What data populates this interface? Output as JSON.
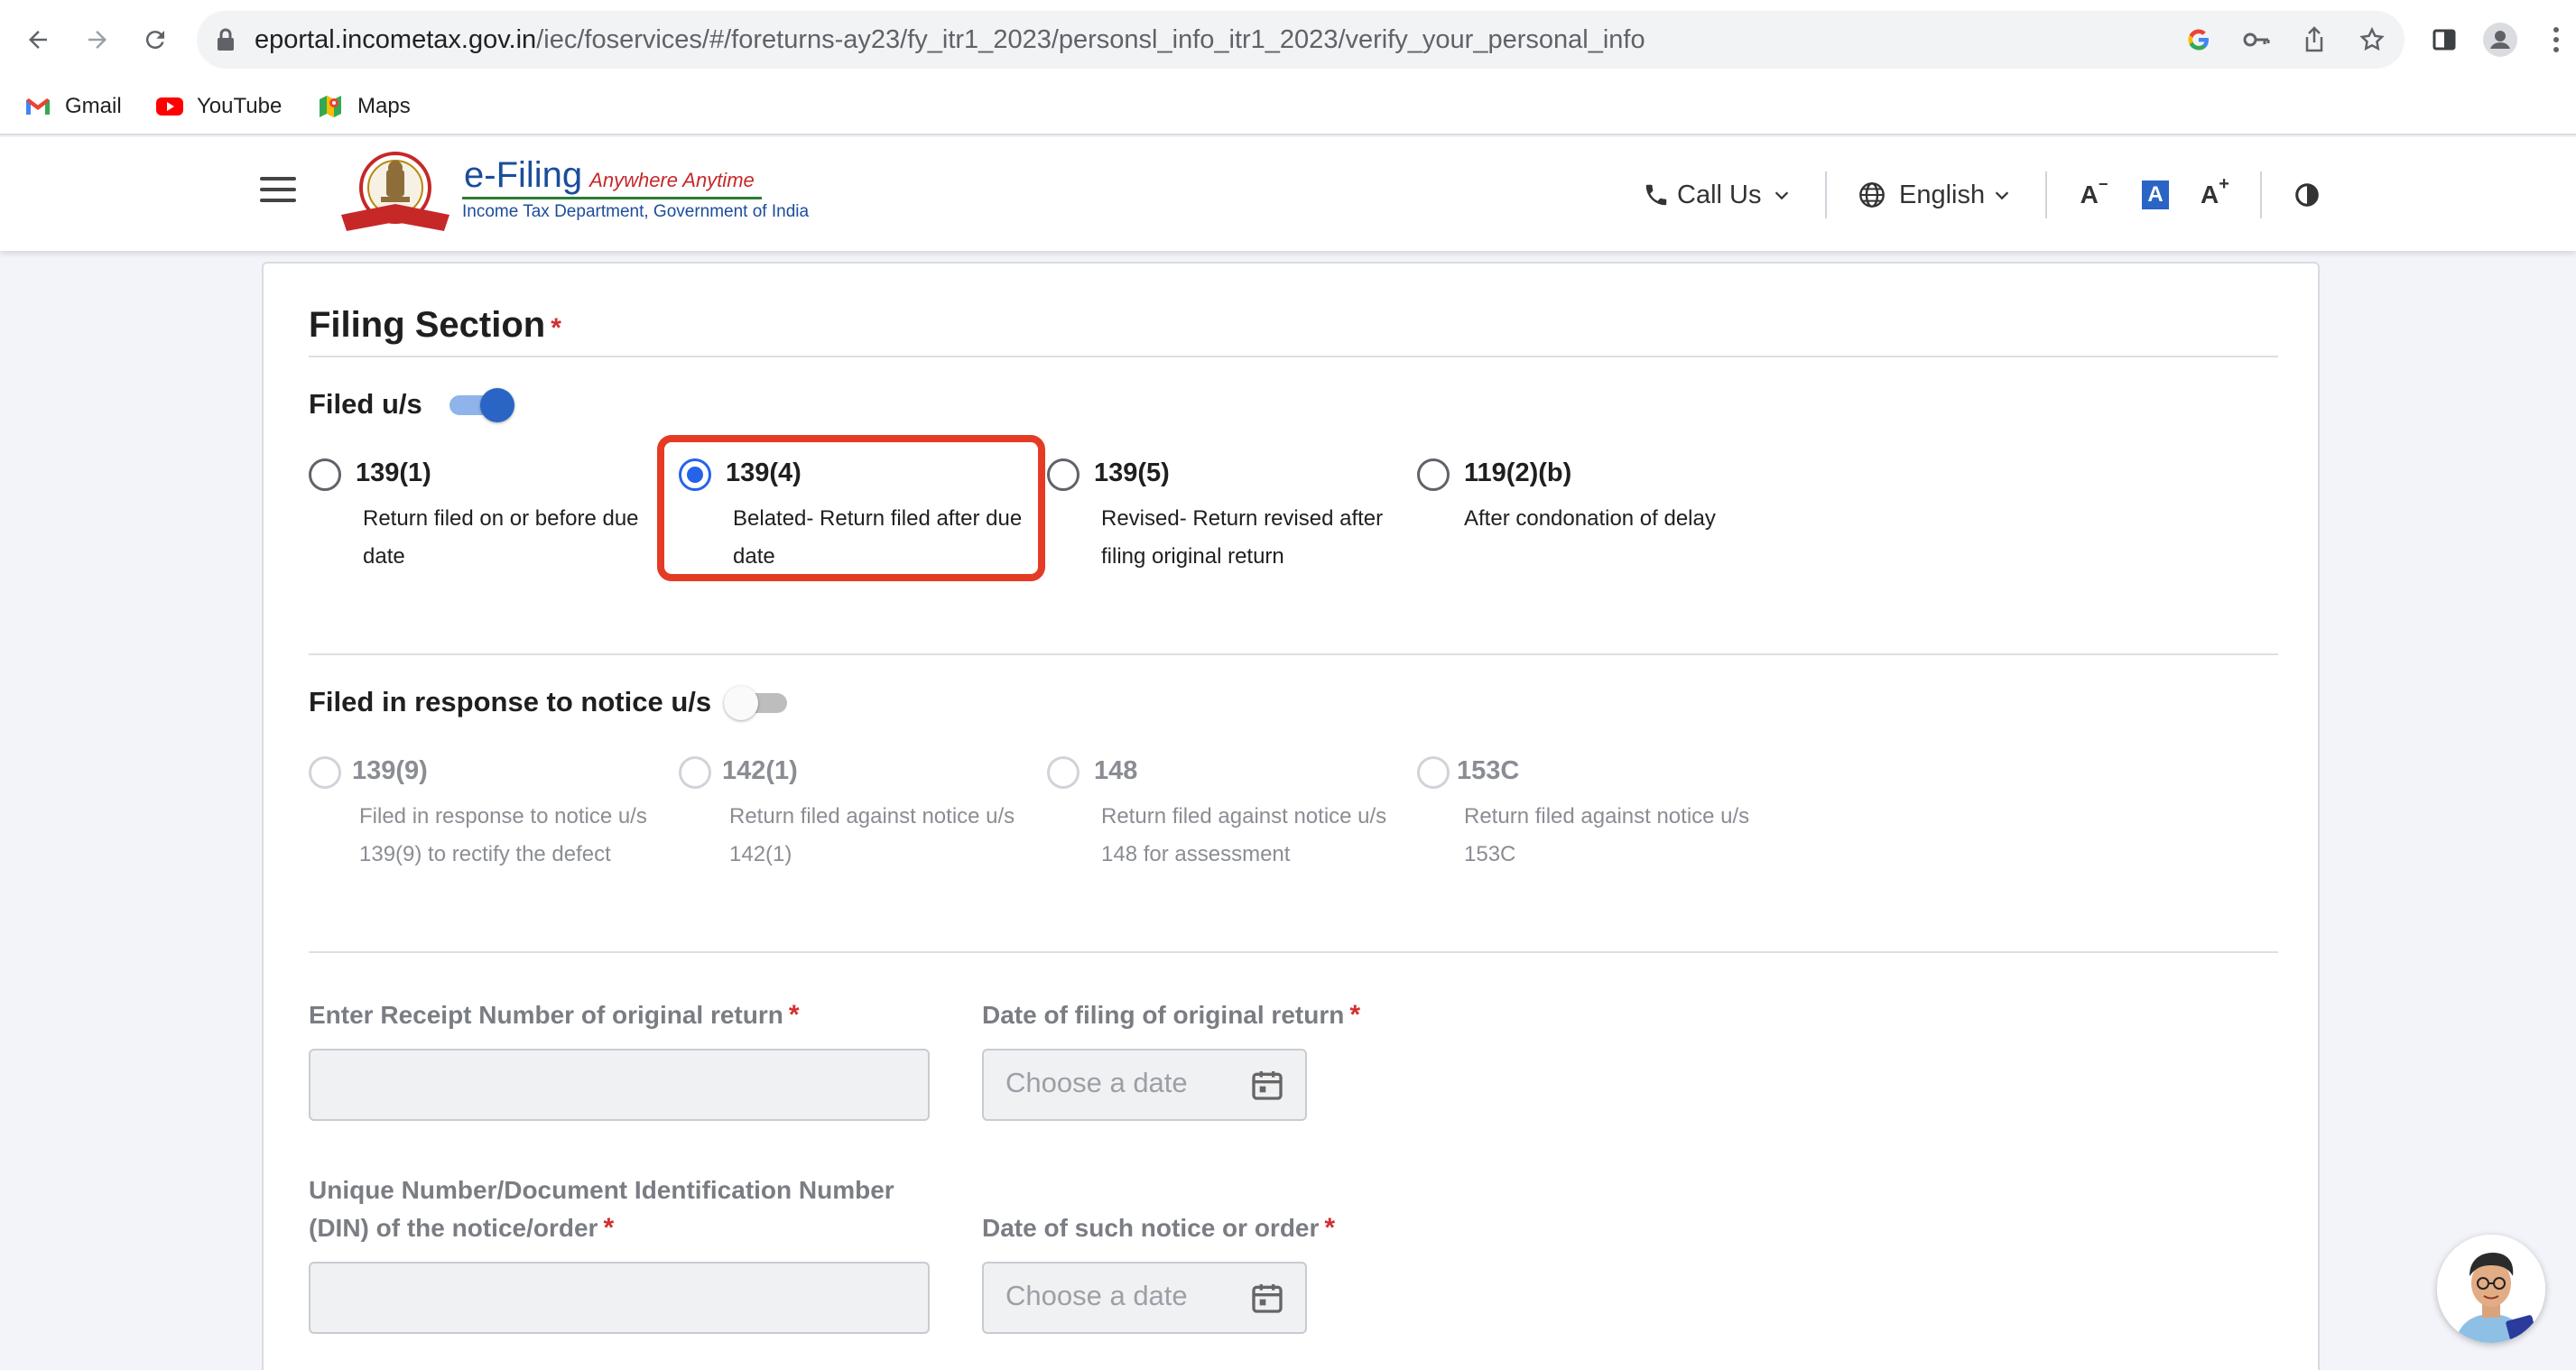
{
  "browser": {
    "url_host": "eportal.incometax.gov.in",
    "url_path": "/iec/foservices/#/foreturns-ay23/fy_itr1_2023/personsl_info_itr1_2023/verify_your_personal_info",
    "bookmarks": [
      {
        "label": "Gmail",
        "icon": "gmail-icon"
      },
      {
        "label": "YouTube",
        "icon": "youtube-icon"
      },
      {
        "label": "Maps",
        "icon": "maps-icon"
      }
    ]
  },
  "header": {
    "logo_title": "e-Filing",
    "logo_tagline": "Anywhere Anytime",
    "logo_subtitle": "Income Tax Department, Government of India",
    "call_us": "Call Us",
    "language": "English",
    "font_decrease": "A",
    "font_normal": "A",
    "font_increase": "A",
    "accent_color": "#1b4d9b"
  },
  "filing_section": {
    "title": "Filing Section",
    "required_mark": "*",
    "filed_us": {
      "label": "Filed u/s",
      "toggle_on": true,
      "options": [
        {
          "code": "139(1)",
          "desc": "Return filed on or before due date",
          "checked": false
        },
        {
          "code": "139(4)",
          "desc": "Belated- Return filed after due date",
          "checked": true
        },
        {
          "code": "139(5)",
          "desc": "Revised- Return revised after filing original return",
          "checked": false
        },
        {
          "code": "119(2)(b)",
          "desc": "After condonation of delay",
          "checked": false
        }
      ]
    },
    "notice": {
      "label": "Filed in response to notice u/s",
      "toggle_on": false,
      "options": [
        {
          "code": "139(9)",
          "desc": "Filed in response to notice u/s 139(9) to rectify the defect"
        },
        {
          "code": "142(1)",
          "desc": "Return filed against notice u/s 142(1)"
        },
        {
          "code": "148",
          "desc": "Return filed against notice u/s 148 for assessment"
        },
        {
          "code": "153C",
          "desc": "Return filed against notice u/s 153C"
        }
      ]
    },
    "fields": {
      "receipt_label": "Enter Receipt Number of original return",
      "receipt_value": "",
      "date_original_label": "Date of filing of original return",
      "date_placeholder": "Choose a date",
      "din_label": "Unique Number/Document Identification Number (DIN) of the notice/order",
      "din_value": "",
      "date_notice_label": "Date of such notice or order"
    }
  }
}
